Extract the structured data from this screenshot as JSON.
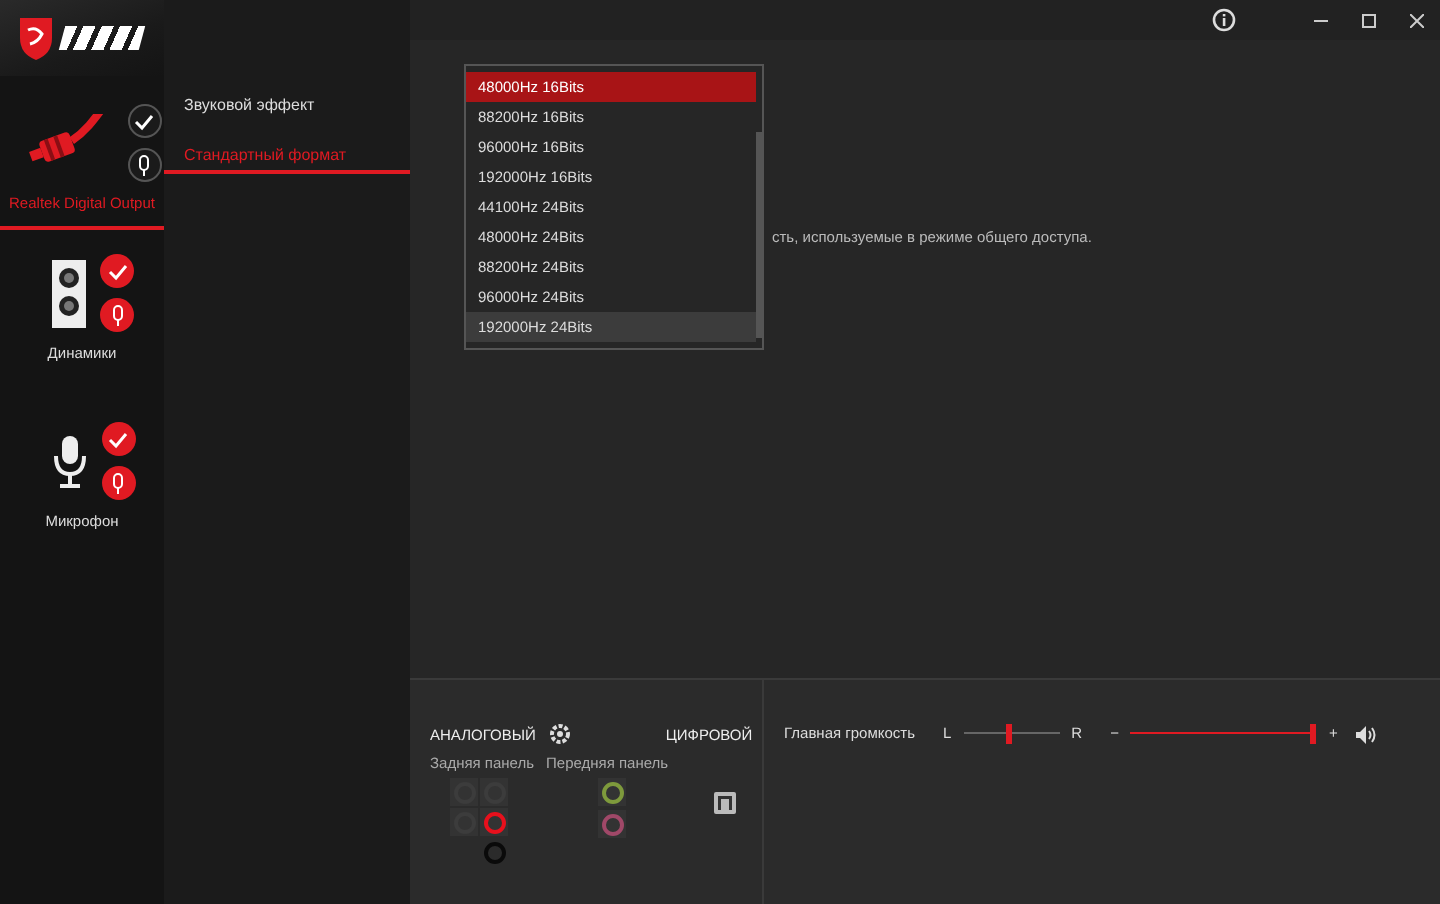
{
  "devices": [
    {
      "name": "Realtek Digital Output",
      "kind": "optical",
      "selected": true,
      "color": "#1a1a1a"
    },
    {
      "name": "Динамики",
      "kind": "speaker",
      "selected": false,
      "color": "#e01a22"
    },
    {
      "name": "Микрофон",
      "kind": "microphone",
      "selected": false,
      "color": "#e01a22"
    }
  ],
  "menu": [
    {
      "label": "Звуковой эффект",
      "selected": false
    },
    {
      "label": "Стандартный формат",
      "selected": true
    }
  ],
  "description": "сть, используемые в режиме общего доступа.",
  "format_list": [
    {
      "label": "48000Hz 16Bits",
      "selected": true,
      "hovered": false
    },
    {
      "label": "88200Hz 16Bits",
      "selected": false,
      "hovered": false
    },
    {
      "label": "96000Hz 16Bits",
      "selected": false,
      "hovered": false
    },
    {
      "label": "192000Hz 16Bits",
      "selected": false,
      "hovered": false
    },
    {
      "label": "44100Hz 24Bits",
      "selected": false,
      "hovered": false
    },
    {
      "label": "48000Hz 24Bits",
      "selected": false,
      "hovered": false
    },
    {
      "label": "88200Hz 24Bits",
      "selected": false,
      "hovered": false
    },
    {
      "label": "96000Hz 24Bits",
      "selected": false,
      "hovered": false
    },
    {
      "label": "192000Hz 24Bits",
      "selected": false,
      "hovered": true
    }
  ],
  "connectors": {
    "analog_title": "АНАЛОГОВЫЙ",
    "digital_title": "ЦИФРОВОЙ",
    "rear_label": "Задняя панель",
    "front_label": "Передняя панель",
    "rear_jacks": [
      {
        "color": "#3c3c3c"
      },
      {
        "color": "#3c3c3c"
      },
      {
        "color": "#3c3c3c"
      },
      {
        "color": "#e8101c"
      }
    ],
    "rear_extra_jack": {
      "color": "#0a0a0a"
    },
    "front_jacks": [
      {
        "color": "#7e9a3c"
      },
      {
        "color": "#a04868"
      }
    ]
  },
  "volume": {
    "label": "Главная громкость",
    "left": "L",
    "right": "R",
    "balance": {
      "level": 0.5
    },
    "minus": "−",
    "plus": "+",
    "master": {
      "level": 1.0
    }
  }
}
